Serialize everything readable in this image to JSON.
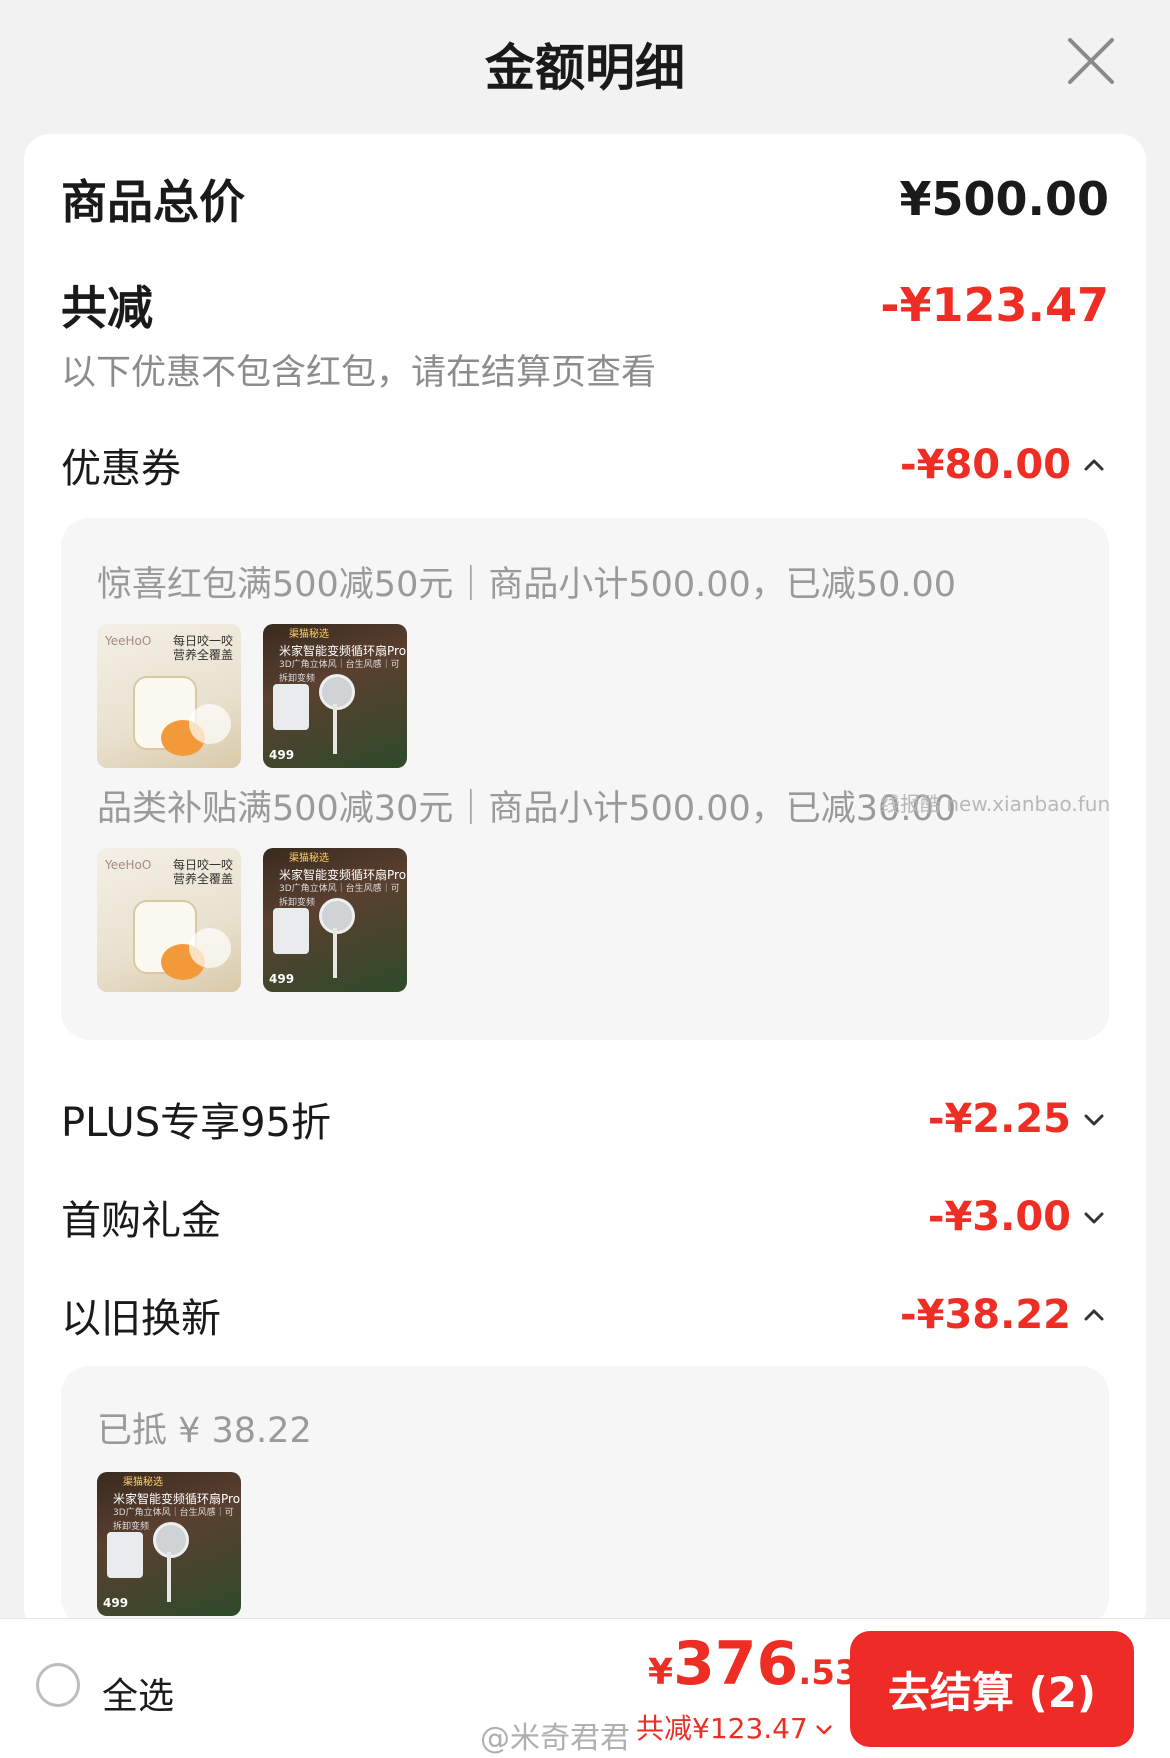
{
  "header": {
    "title": "金额明细",
    "close_icon": "close-icon"
  },
  "summary": {
    "total_label": "商品总价",
    "total_value": "¥500.00",
    "discount_label": "共减",
    "discount_value": "-¥123.47",
    "note": "以下优惠不包含红包，请在结算页查看"
  },
  "coupon": {
    "label": "优惠券",
    "value": "-¥80.00",
    "expanded": true,
    "rules": [
      {
        "text": "惊喜红包满500减50元｜商品小计500.00，已减50.00"
      },
      {
        "text": "品类补贴满500减30元｜商品小计500.00，已减30.00"
      }
    ]
  },
  "thumbs": {
    "cup": {
      "line1": "每日咬一咬",
      "line2": "营养全覆盖",
      "brand": "YeeHoO"
    },
    "fan": {
      "tag": "渠猫秘选",
      "title": "米家智能变频循环扇Pro",
      "sub": "3D广角立体风｜台生风感｜可拆卸变频",
      "price": "499"
    }
  },
  "plus": {
    "label": "PLUS专享95折",
    "value": "-¥2.25",
    "expanded": false
  },
  "first": {
    "label": "首购礼金",
    "value": "-¥3.00",
    "expanded": false
  },
  "tradein": {
    "label": "以旧换新",
    "value": "-¥38.22",
    "expanded": true,
    "detail": "已抵 ¥ 38.22"
  },
  "watermark": "线报酷 new.xianbao.fun",
  "bottom": {
    "select_all": "全选",
    "currency": "¥",
    "total_int": "376",
    "total_dec": ".53",
    "saving": "共减¥123.47",
    "checkout": "去结算 (2)",
    "footer_mark": "@米奇君君"
  },
  "colors": {
    "accent": "#ee2e24",
    "checkout_bg": "#ee2b26"
  }
}
